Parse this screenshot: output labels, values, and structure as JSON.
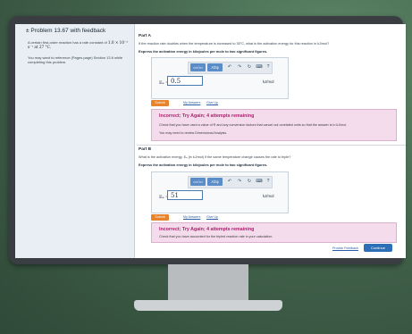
{
  "problem": {
    "title": "± Problem 13.67 with feedback",
    "text_intro": "A certain first-order reaction has a rate constant of",
    "text_math": "1.0 × 10⁻³ s⁻¹ at 27 °C.",
    "reference": "You may want to reference (Pages page) Section 13.6 while completing this problem."
  },
  "toolbar": {
    "template_label": "▭√▭",
    "symbols_label": "ΑΣφ",
    "undo_icon": "undo-icon",
    "redo_icon": "redo-icon",
    "reset_icon": "reset-icon",
    "keyboard_icon": "keyboard-icon",
    "help_label": "?"
  },
  "parts": [
    {
      "label": "Part A",
      "question": "If the reaction rate doubles when the temperature is increased to 35°C, what is the activation energy for this reaction in kJ/mol?",
      "instruction": "Express the activation energy in kilojoules per mole to two significant figures.",
      "answer_label": "Eₐ =",
      "answer_value": "0.5",
      "unit": "kJ/mol",
      "submit_label": "Submit",
      "my_answers": "My Answers",
      "give_up": "Give Up",
      "feedback_title": "Incorrect; Try Again; 4 attempts remaining",
      "feedback_text": "Check that you have used a value of R and any conversion factors that cancel out unrelated units so that the answer is in kJ/mol.",
      "feedback_review": "You may need to review Dimensional Analysis."
    },
    {
      "label": "Part B",
      "question": "What is the activation energy, Eₐ (in kJ/mol) if the same temperature change causes the rate to triple?",
      "instruction": "Express the activation energy in kilojoules per mole to two significant figures.",
      "answer_label": "Eₐ =",
      "answer_value": "51",
      "unit": "kJ/mol",
      "submit_label": "Submit",
      "my_answers": "My Answers",
      "give_up": "Give Up",
      "feedback_title": "Incorrect; Try Again; 4 attempts remaining",
      "feedback_text": "Check that you have accounted for the tripled reaction rate in your calculation."
    }
  ],
  "footer": {
    "provide_feedback": "Provide Feedback",
    "continue_label": "Continue"
  },
  "colors": {
    "submit": "#e8832b",
    "feedback_bg": "#f4dcec",
    "feedback_title": "#b01c6e",
    "continue": "#2d6fb7",
    "link": "#2a5ea8"
  }
}
